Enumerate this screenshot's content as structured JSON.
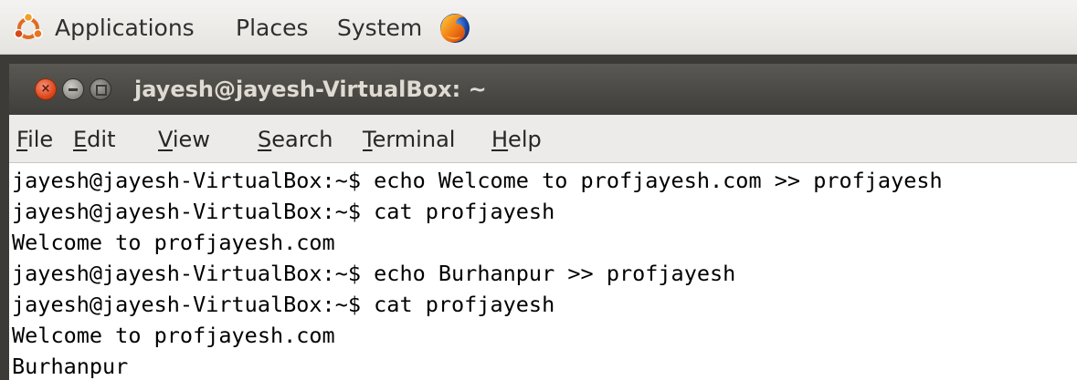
{
  "panel": {
    "menus": [
      "Applications",
      "Places",
      "System"
    ],
    "icons": {
      "applications": "ubuntu-logo-icon",
      "browser": "firefox-icon"
    }
  },
  "window": {
    "title": "jayesh@jayesh-VirtualBox: ~",
    "buttons": [
      "close",
      "minimize",
      "maximize"
    ]
  },
  "menubar": {
    "items": [
      {
        "label": "File",
        "mnemonic": "F",
        "rest": "ile"
      },
      {
        "label": "Edit",
        "mnemonic": "E",
        "rest": "dit"
      },
      {
        "label": "View",
        "mnemonic": "V",
        "rest": "iew"
      },
      {
        "label": "Search",
        "mnemonic": "S",
        "rest": "earch"
      },
      {
        "label": "Terminal",
        "mnemonic": "T",
        "rest": "erminal"
      },
      {
        "label": "Help",
        "mnemonic": "H",
        "rest": "elp"
      }
    ]
  },
  "terminal": {
    "lines": [
      "jayesh@jayesh-VirtualBox:~$ echo Welcome to profjayesh.com >> profjayesh",
      "jayesh@jayesh-VirtualBox:~$ cat profjayesh",
      "Welcome to profjayesh.com",
      "jayesh@jayesh-VirtualBox:~$ echo Burhanpur >> profjayesh",
      "jayesh@jayesh-VirtualBox:~$ cat profjayesh",
      "Welcome to profjayesh.com",
      "Burhanpur"
    ]
  },
  "colors": {
    "panel": "#e9e7e3",
    "titlebar": "#4a4945",
    "close_button": "#df4a1f",
    "menubar": "#edebe9",
    "terminal_bg": "#ffffff",
    "terminal_fg": "#000000"
  }
}
